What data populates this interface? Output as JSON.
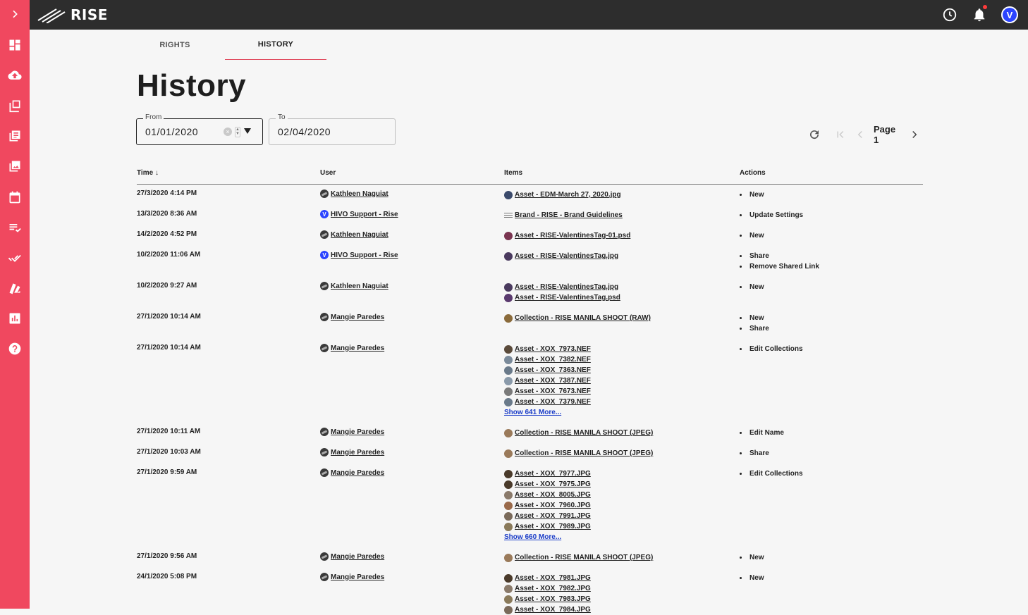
{
  "app": {
    "logo_text": "RISE"
  },
  "sidebar": {
    "items": [
      {
        "name": "expand",
        "icon": "chevron-right-icon"
      },
      {
        "name": "dashboard",
        "icon": "dashboard-icon"
      },
      {
        "name": "upload",
        "icon": "cloud-upload-icon"
      },
      {
        "name": "library",
        "icon": "library-icon"
      },
      {
        "name": "collections",
        "icon": "collections-icon"
      },
      {
        "name": "gallery",
        "icon": "photo-album-icon"
      },
      {
        "name": "calendar",
        "icon": "calendar-icon"
      },
      {
        "name": "tasks",
        "icon": "checklist-icon"
      },
      {
        "name": "approvals",
        "icon": "double-check-icon"
      },
      {
        "name": "brand",
        "icon": "swatch-icon"
      },
      {
        "name": "reports",
        "icon": "bar-chart-icon"
      },
      {
        "name": "help",
        "icon": "help-icon"
      }
    ]
  },
  "header": {
    "avatar_letter": "V"
  },
  "tabs": [
    {
      "label": "RIGHTS",
      "active": false
    },
    {
      "label": "HISTORY",
      "active": true
    }
  ],
  "page_title": "History",
  "filters": {
    "from_label": "From",
    "from_value": "01/01/2020",
    "to_label": "To",
    "to_value": "02/04/2020"
  },
  "pager": {
    "label": "Page 1"
  },
  "table": {
    "headers": {
      "time": "Time ↓",
      "user": "User",
      "items": "Items",
      "actions": "Actions"
    },
    "rows": [
      {
        "time": "27/3/2020 4:14 PM",
        "user": "Kathleen Naguiat",
        "user_icon": "photo",
        "items": [
          {
            "label": "Asset - EDM-March 27, 2020.jpg",
            "thumb": "#3b4a6b"
          }
        ],
        "more": "",
        "actions": [
          "New"
        ]
      },
      {
        "time": "13/3/2020 8:36 AM",
        "user": "HIVO Support - Rise",
        "user_icon": "v",
        "items": [
          {
            "label": "Brand - RISE - Brand Guidelines",
            "thumb": "list"
          }
        ],
        "more": "",
        "actions": [
          "Update Settings"
        ]
      },
      {
        "time": "14/2/2020 4:52 PM",
        "user": "Kathleen Naguiat",
        "user_icon": "photo",
        "items": [
          {
            "label": "Asset - RISE-ValentinesTag-01.psd",
            "thumb": "#7a3550"
          }
        ],
        "more": "",
        "actions": [
          "New"
        ]
      },
      {
        "time": "10/2/2020 11:06 AM",
        "user": "HIVO Support - Rise",
        "user_icon": "v",
        "items": [
          {
            "label": "Asset - RISE-ValentinesTag.jpg",
            "thumb": "#4a3a5e"
          }
        ],
        "more": "",
        "actions": [
          "Share",
          "Remove Shared Link"
        ]
      },
      {
        "time": "10/2/2020 9:27 AM",
        "user": "Kathleen Naguiat",
        "user_icon": "photo",
        "items": [
          {
            "label": "Asset - RISE-ValentinesTag.jpg",
            "thumb": "#4a3a5e"
          },
          {
            "label": "Asset - RISE-ValentinesTag.psd",
            "thumb": "#5a3a6e"
          }
        ],
        "more": "",
        "actions": [
          "New"
        ]
      },
      {
        "time": "27/1/2020 10:14 AM",
        "user": "Mangie Paredes",
        "user_icon": "photo",
        "items": [
          {
            "label": "Collection - RISE MANILA SHOOT (RAW)",
            "thumb": "#8a6a3a"
          }
        ],
        "more": "",
        "actions": [
          "New",
          "Share"
        ]
      },
      {
        "time": "27/1/2020 10:14 AM",
        "user": "Mangie Paredes",
        "user_icon": "photo",
        "items": [
          {
            "label": "Asset - XOX_7973.NEF",
            "thumb": "#5a4a3a"
          },
          {
            "label": "Asset - XOX_7382.NEF",
            "thumb": "#7a8a9a"
          },
          {
            "label": "Asset - XOX_7363.NEF",
            "thumb": "#6a7a8a"
          },
          {
            "label": "Asset - XOX_7387.NEF",
            "thumb": "#8a9aaa"
          },
          {
            "label": "Asset - XOX_7673.NEF",
            "thumb": "#7a7a7a"
          },
          {
            "label": "Asset - XOX_7379.NEF",
            "thumb": "#6a7a8a"
          }
        ],
        "more": "Show 641 More...",
        "actions": [
          "Edit Collections"
        ]
      },
      {
        "time": "27/1/2020 10:11 AM",
        "user": "Mangie Paredes",
        "user_icon": "photo",
        "items": [
          {
            "label": "Collection - RISE MANILA SHOOT (JPEG)",
            "thumb": "#9a7a5a"
          }
        ],
        "more": "",
        "actions": [
          "Edit Name"
        ]
      },
      {
        "time": "27/1/2020 10:03 AM",
        "user": "Mangie Paredes",
        "user_icon": "photo",
        "items": [
          {
            "label": "Collection - RISE MANILA SHOOT (JPEG)",
            "thumb": "#9a7a5a"
          }
        ],
        "more": "",
        "actions": [
          "Share"
        ]
      },
      {
        "time": "27/1/2020 9:59 AM",
        "user": "Mangie Paredes",
        "user_icon": "photo",
        "items": [
          {
            "label": "Asset - XOX_7977.JPG",
            "thumb": "#4a3a2a"
          },
          {
            "label": "Asset - XOX_7975.JPG",
            "thumb": "#4a3a2a"
          },
          {
            "label": "Asset - XOX_8005.JPG",
            "thumb": "#8a7a6a"
          },
          {
            "label": "Asset - XOX_7960.JPG",
            "thumb": "#9a6a4a"
          },
          {
            "label": "Asset - XOX_7991.JPG",
            "thumb": "#7a6a5a"
          },
          {
            "label": "Asset - XOX_7989.JPG",
            "thumb": "#8a7a5a"
          }
        ],
        "more": "Show 660 More...",
        "actions": [
          "Edit Collections"
        ]
      },
      {
        "time": "27/1/2020 9:56 AM",
        "user": "Mangie Paredes",
        "user_icon": "photo",
        "items": [
          {
            "label": "Collection - RISE MANILA SHOOT (JPEG)",
            "thumb": "#9a7a5a"
          }
        ],
        "more": "",
        "actions": [
          "New"
        ]
      },
      {
        "time": "24/1/2020 5:08 PM",
        "user": "Mangie Paredes",
        "user_icon": "photo",
        "items": [
          {
            "label": "Asset - XOX_7981.JPG",
            "thumb": "#4a3a2a"
          },
          {
            "label": "Asset - XOX_7982.JPG",
            "thumb": "#8a7a6a"
          },
          {
            "label": "Asset - XOX_7983.JPG",
            "thumb": "#8a7a5a"
          },
          {
            "label": "Asset - XOX_7984.JPG",
            "thumb": "#7a6a5a"
          }
        ],
        "more": "",
        "actions": [
          "New"
        ]
      }
    ]
  }
}
